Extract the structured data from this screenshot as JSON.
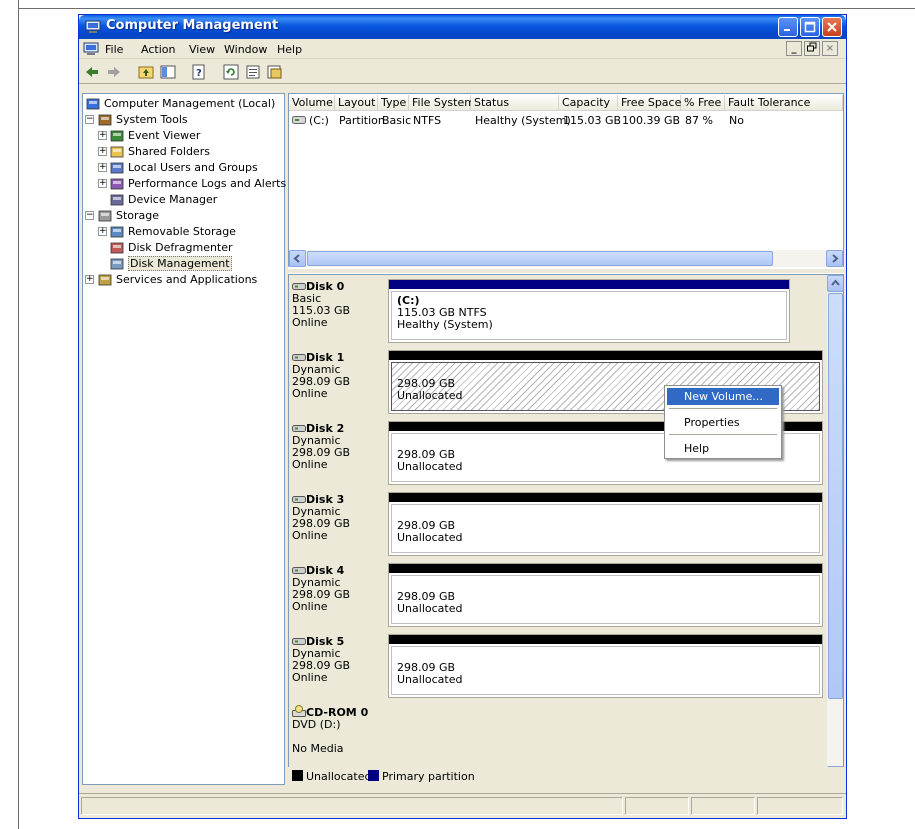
{
  "window": {
    "title": "Computer Management"
  },
  "menu": {
    "items": [
      "File",
      "Action",
      "View",
      "Window",
      "Help"
    ]
  },
  "tree": {
    "items": [
      {
        "label": "Computer Management (Local)",
        "icon": "computer-icon",
        "level": 0,
        "expander": ""
      },
      {
        "label": "System Tools",
        "icon": "tools-icon",
        "level": 1,
        "expander": "−"
      },
      {
        "label": "Event Viewer",
        "icon": "event-viewer-icon",
        "level": 2,
        "expander": "+"
      },
      {
        "label": "Shared Folders",
        "icon": "folder-icon",
        "level": 2,
        "expander": "+"
      },
      {
        "label": "Local Users and Groups",
        "icon": "users-icon",
        "level": 2,
        "expander": "+"
      },
      {
        "label": "Performance Logs and Alerts",
        "icon": "performance-icon",
        "level": 2,
        "expander": "+"
      },
      {
        "label": "Device Manager",
        "icon": "device-manager-icon",
        "level": 2,
        "expander": ""
      },
      {
        "label": "Storage",
        "icon": "storage-icon",
        "level": 1,
        "expander": "−"
      },
      {
        "label": "Removable Storage",
        "icon": "removable-storage-icon",
        "level": 2,
        "expander": "+"
      },
      {
        "label": "Disk Defragmenter",
        "icon": "defragmenter-icon",
        "level": 2,
        "expander": ""
      },
      {
        "label": "Disk Management",
        "icon": "disk-management-icon",
        "level": 2,
        "expander": "",
        "selected": true
      },
      {
        "label": "Services and Applications",
        "icon": "services-icon",
        "level": 1,
        "expander": "+"
      }
    ]
  },
  "volume_table": {
    "columns": [
      "Volume",
      "Layout",
      "Type",
      "File System",
      "Status",
      "Capacity",
      "Free Space",
      "% Free",
      "Fault Tolerance"
    ],
    "rows": [
      {
        "volume": "(C:)",
        "layout": "Partition",
        "type": "Basic",
        "file_system": "NTFS",
        "status": "Healthy (System)",
        "capacity": "115.03 GB",
        "free_space": "100.39 GB",
        "percent_free": "87 %",
        "fault_tolerance": "No"
      }
    ]
  },
  "disks": [
    {
      "name": "Disk 0",
      "type": "Basic",
      "size": "115.03 GB",
      "state": "Online",
      "vol_label": "(C:)",
      "vol_size": "115.03 GB NTFS",
      "vol_status": "Healthy (System)",
      "stripe_color": "#000080",
      "hatched": false
    },
    {
      "name": "Disk 1",
      "type": "Dynamic",
      "size": "298.09 GB",
      "state": "Online",
      "vol_label": "",
      "vol_size": "298.09 GB",
      "vol_status": "Unallocated",
      "stripe_color": "#000000",
      "hatched": true
    },
    {
      "name": "Disk 2",
      "type": "Dynamic",
      "size": "298.09 GB",
      "state": "Online",
      "vol_label": "",
      "vol_size": "298.09 GB",
      "vol_status": "Unallocated",
      "stripe_color": "#000000",
      "hatched": false
    },
    {
      "name": "Disk 3",
      "type": "Dynamic",
      "size": "298.09 GB",
      "state": "Online",
      "vol_label": "",
      "vol_size": "298.09 GB",
      "vol_status": "Unallocated",
      "stripe_color": "#000000",
      "hatched": false
    },
    {
      "name": "Disk 4",
      "type": "Dynamic",
      "size": "298.09 GB",
      "state": "Online",
      "vol_label": "",
      "vol_size": "298.09 GB",
      "vol_status": "Unallocated",
      "stripe_color": "#000000",
      "hatched": false
    },
    {
      "name": "Disk 5",
      "type": "Dynamic",
      "size": "298.09 GB",
      "state": "Online",
      "vol_label": "",
      "vol_size": "298.09 GB",
      "vol_status": "Unallocated",
      "stripe_color": "#000000",
      "hatched": false
    }
  ],
  "cdrom": {
    "name": "CD-ROM 0",
    "type": "DVD (D:)",
    "state": "No Media"
  },
  "legend": {
    "items": [
      {
        "label": "Unallocated",
        "color": "#000000"
      },
      {
        "label": "Primary partition",
        "color": "#000080"
      }
    ]
  },
  "context_menu": {
    "items": [
      {
        "label": "New Volume...",
        "highlighted": true
      },
      {
        "label": "Properties",
        "highlighted": false
      },
      {
        "label": "Help",
        "highlighted": false
      }
    ]
  },
  "colors": {
    "titlebar": "#0a5fe5",
    "selection": "#316ac5",
    "primary_partition": "#000080",
    "unallocated": "#000000"
  }
}
